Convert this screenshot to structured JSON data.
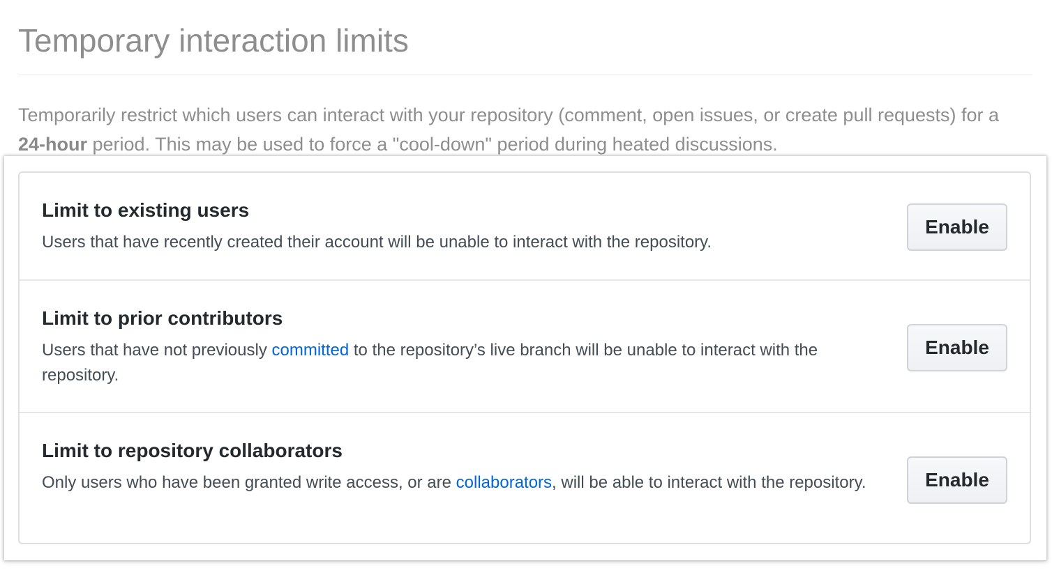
{
  "header": {
    "title": "Temporary interaction limits"
  },
  "intro": {
    "before": "Temporarily restrict which users can interact with your repository (comment, open issues, or create pull requests) for a ",
    "bold": "24-hour",
    "after": " period. This may be used to force a \"cool-down\" period during heated discussions."
  },
  "limits": [
    {
      "title": "Limit to existing users",
      "desc_before": "Users that have recently created their account will be unable to interact with the repository.",
      "button_label": "Enable"
    },
    {
      "title": "Limit to prior contributors",
      "desc_before": "Users that have not previously ",
      "link_text": "committed",
      "desc_after": " to the repository’s live branch will be unable to interact with the repository.",
      "button_label": "Enable"
    },
    {
      "title": "Limit to repository collaborators",
      "desc_before": "Only users who have been granted write access, or are ",
      "link_text": "collaborators",
      "desc_after": ", will be able to interact with the repository.",
      "button_label": "Enable"
    }
  ],
  "colors": {
    "link": "#0366d6",
    "muted_text": "#8e8e8e",
    "body_text": "#24292e",
    "border": "#dcdfe3"
  }
}
